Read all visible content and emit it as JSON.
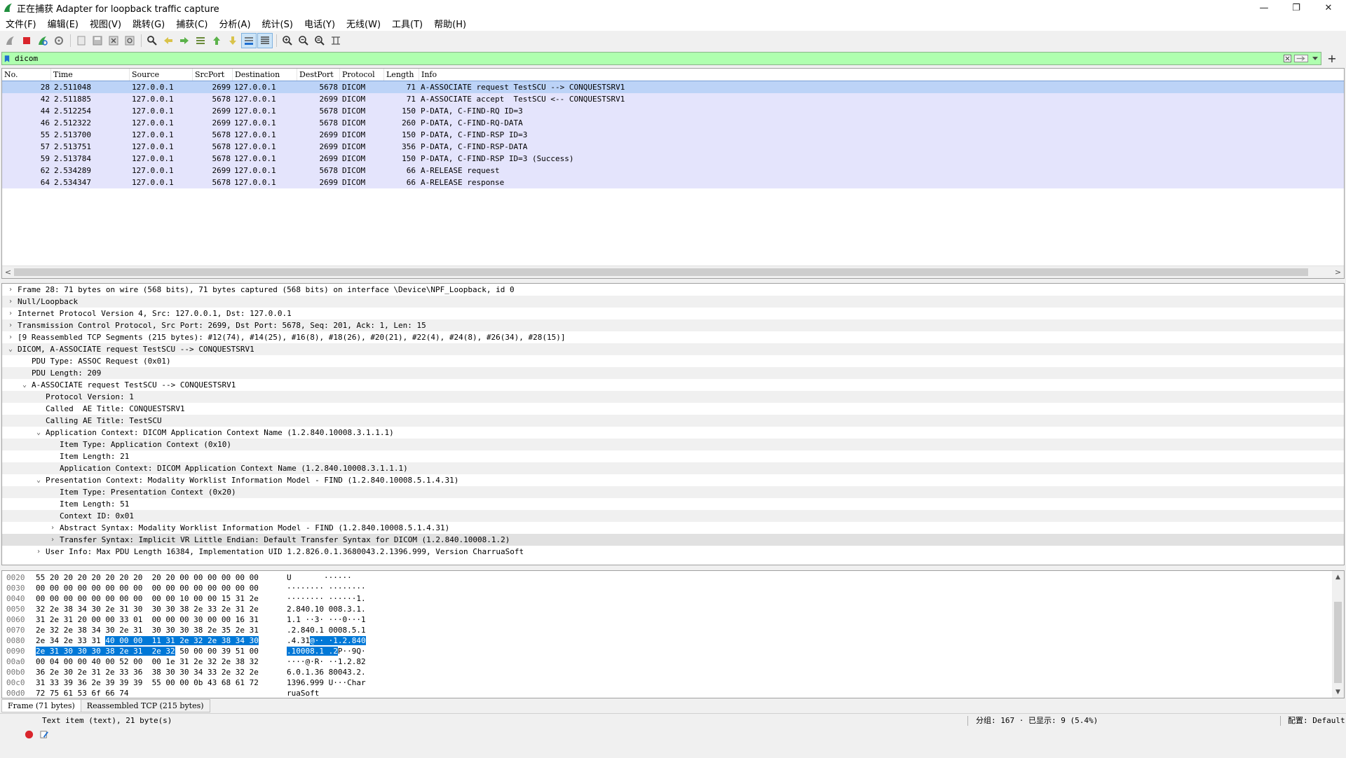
{
  "window": {
    "title": "正在捕获 Adapter for loopback traffic capture",
    "controls": {
      "minimize": "—",
      "maximize": "❐",
      "close": "✕"
    }
  },
  "menu": [
    "文件(F)",
    "编辑(E)",
    "视图(V)",
    "跳转(G)",
    "捕获(C)",
    "分析(A)",
    "统计(S)",
    "电话(Y)",
    "无线(W)",
    "工具(T)",
    "帮助(H)"
  ],
  "filter": {
    "value": "dicom",
    "plus": "+"
  },
  "colors": {
    "filter_bg": "#afffaf",
    "row_bg": "#e4e4fc",
    "row_selected": "#bcd3f7",
    "byte_selection": "#0078d7"
  },
  "packet_list": {
    "columns": [
      "No.",
      "Time",
      "Source",
      "SrcPort",
      "Destination",
      "DestPort",
      "Protocol",
      "Length",
      "Info"
    ],
    "rows": [
      {
        "no": "28",
        "time": "2.511048",
        "src": "127.0.0.1",
        "sport": "2699",
        "dst": "127.0.0.1",
        "dport": "5678",
        "proto": "DICOM",
        "len": "71",
        "info": "A-ASSOCIATE request TestSCU --> CONQUESTSRV1"
      },
      {
        "no": "42",
        "time": "2.511885",
        "src": "127.0.0.1",
        "sport": "5678",
        "dst": "127.0.0.1",
        "dport": "2699",
        "proto": "DICOM",
        "len": "71",
        "info": "A-ASSOCIATE accept  TestSCU <-- CONQUESTSRV1"
      },
      {
        "no": "44",
        "time": "2.512254",
        "src": "127.0.0.1",
        "sport": "2699",
        "dst": "127.0.0.1",
        "dport": "5678",
        "proto": "DICOM",
        "len": "150",
        "info": "P-DATA, C-FIND-RQ ID=3"
      },
      {
        "no": "46",
        "time": "2.512322",
        "src": "127.0.0.1",
        "sport": "2699",
        "dst": "127.0.0.1",
        "dport": "5678",
        "proto": "DICOM",
        "len": "260",
        "info": "P-DATA, C-FIND-RQ-DATA"
      },
      {
        "no": "55",
        "time": "2.513700",
        "src": "127.0.0.1",
        "sport": "5678",
        "dst": "127.0.0.1",
        "dport": "2699",
        "proto": "DICOM",
        "len": "150",
        "info": "P-DATA, C-FIND-RSP ID=3"
      },
      {
        "no": "57",
        "time": "2.513751",
        "src": "127.0.0.1",
        "sport": "5678",
        "dst": "127.0.0.1",
        "dport": "2699",
        "proto": "DICOM",
        "len": "356",
        "info": "P-DATA, C-FIND-RSP-DATA"
      },
      {
        "no": "59",
        "time": "2.513784",
        "src": "127.0.0.1",
        "sport": "5678",
        "dst": "127.0.0.1",
        "dport": "2699",
        "proto": "DICOM",
        "len": "150",
        "info": "P-DATA, C-FIND-RSP ID=3 (Success)"
      },
      {
        "no": "62",
        "time": "2.534289",
        "src": "127.0.0.1",
        "sport": "2699",
        "dst": "127.0.0.1",
        "dport": "5678",
        "proto": "DICOM",
        "len": "66",
        "info": "A-RELEASE request"
      },
      {
        "no": "64",
        "time": "2.534347",
        "src": "127.0.0.1",
        "sport": "5678",
        "dst": "127.0.0.1",
        "dport": "2699",
        "proto": "DICOM",
        "len": "66",
        "info": "A-RELEASE response"
      }
    ]
  },
  "details": [
    {
      "indent": 0,
      "arrow": "right",
      "text": "Frame 28: 71 bytes on wire (568 bits), 71 bytes captured (568 bits) on interface \\Device\\NPF_Loopback, id 0"
    },
    {
      "indent": 0,
      "arrow": "right",
      "text": "Null/Loopback"
    },
    {
      "indent": 0,
      "arrow": "right",
      "text": "Internet Protocol Version 4, Src: 127.0.0.1, Dst: 127.0.0.1"
    },
    {
      "indent": 0,
      "arrow": "right",
      "text": "Transmission Control Protocol, Src Port: 2699, Dst Port: 5678, Seq: 201, Ack: 1, Len: 15"
    },
    {
      "indent": 0,
      "arrow": "right",
      "text": "[9 Reassembled TCP Segments (215 bytes): #12(74), #14(25), #16(8), #18(26), #20(21), #22(4), #24(8), #26(34), #28(15)]"
    },
    {
      "indent": 0,
      "arrow": "down",
      "text": "DICOM, A-ASSOCIATE request TestSCU --> CONQUESTSRV1"
    },
    {
      "indent": 1,
      "arrow": "",
      "text": "PDU Type: ASSOC Request (0x01)"
    },
    {
      "indent": 1,
      "arrow": "",
      "text": "PDU Length: 209"
    },
    {
      "indent": 1,
      "arrow": "down",
      "text": "A-ASSOCIATE request TestSCU --> CONQUESTSRV1"
    },
    {
      "indent": 2,
      "arrow": "",
      "text": "Protocol Version: 1"
    },
    {
      "indent": 2,
      "arrow": "",
      "text": "Called  AE Title: CONQUESTSRV1"
    },
    {
      "indent": 2,
      "arrow": "",
      "text": "Calling AE Title: TestSCU"
    },
    {
      "indent": 2,
      "arrow": "down",
      "text": "Application Context: DICOM Application Context Name (1.2.840.10008.3.1.1.1)"
    },
    {
      "indent": 3,
      "arrow": "",
      "text": "Item Type: Application Context (0x10)"
    },
    {
      "indent": 3,
      "arrow": "",
      "text": "Item Length: 21"
    },
    {
      "indent": 3,
      "arrow": "",
      "text": "Application Context: DICOM Application Context Name (1.2.840.10008.3.1.1.1)"
    },
    {
      "indent": 2,
      "arrow": "down",
      "text": "Presentation Context: Modality Worklist Information Model - FIND (1.2.840.10008.5.1.4.31)"
    },
    {
      "indent": 3,
      "arrow": "",
      "text": "Item Type: Presentation Context (0x20)"
    },
    {
      "indent": 3,
      "arrow": "",
      "text": "Item Length: 51"
    },
    {
      "indent": 3,
      "arrow": "",
      "text": "Context ID: 0x01"
    },
    {
      "indent": 3,
      "arrow": "right",
      "text": "Abstract Syntax: Modality Worklist Information Model - FIND (1.2.840.10008.5.1.4.31)"
    },
    {
      "indent": 3,
      "arrow": "right",
      "text": "Transfer Syntax: Implicit VR Little Endian: Default Transfer Syntax for DICOM (1.2.840.10008.1.2)",
      "highlight": true
    },
    {
      "indent": 2,
      "arrow": "right",
      "text": "User Info: Max PDU Length 16384, Implementation UID 1.2.826.0.1.3680043.2.1396.999, Version CharruaSoft"
    }
  ],
  "bytes": [
    {
      "off": "0020",
      "pre": "55 20 20 20 20 20 20 20  20 20 00 00 00 00 00 00",
      "sel": "",
      "post": "",
      "apre": "U       ······",
      "asel": "",
      "apost": ""
    },
    {
      "off": "0030",
      "pre": "00 00 00 00 00 00 00 00  00 00 00 00 00 00 00 00",
      "sel": "",
      "post": "",
      "apre": "········ ········",
      "asel": "",
      "apost": ""
    },
    {
      "off": "0040",
      "pre": "00 00 00 00 00 00 00 00  00 00 10 00 00 15 31 2e",
      "sel": "",
      "post": "",
      "apre": "········ ······1.",
      "asel": "",
      "apost": ""
    },
    {
      "off": "0050",
      "pre": "32 2e 38 34 30 2e 31 30  30 30 38 2e 33 2e 31 2e",
      "sel": "",
      "post": "",
      "apre": "2.840.10 008.3.1.",
      "asel": "",
      "apost": ""
    },
    {
      "off": "0060",
      "pre": "31 2e 31 20 00 00 33 01  00 00 00 30 00 00 16 31",
      "sel": "",
      "post": "",
      "apre": "1.1 ··3· ···0···1",
      "asel": "",
      "apost": ""
    },
    {
      "off": "0070",
      "pre": "2e 32 2e 38 34 30 2e 31  30 30 30 38 2e 35 2e 31",
      "sel": "",
      "post": "",
      "apre": ".2.840.1 0008.5.1",
      "asel": "",
      "apost": ""
    },
    {
      "off": "0080",
      "pre": "2e 34 2e 33 31 ",
      "sel": "40 00 00  11 31 2e 32 2e 38 34 30",
      "post": "",
      "apre": ".4.31",
      "asel": "@·· ·1.2.840",
      "apost": ""
    },
    {
      "off": "0090",
      "pre": "",
      "sel": "2e 31 30 30 30 38 2e 31  2e 32",
      "post": " 50 00 00 39 51 00",
      "apre": "",
      "asel": ".10008.1 .2",
      "apost": "P··9Q·"
    },
    {
      "off": "00a0",
      "pre": "00 04 00 00 40 00 52 00  00 1e 31 2e 32 2e 38 32",
      "sel": "",
      "post": "",
      "apre": "····@·R· ··1.2.82",
      "asel": "",
      "apost": ""
    },
    {
      "off": "00b0",
      "pre": "36 2e 30 2e 31 2e 33 36  38 30 30 34 33 2e 32 2e",
      "sel": "",
      "post": "",
      "apre": "6.0.1.36 80043.2.",
      "asel": "",
      "apost": ""
    },
    {
      "off": "00c0",
      "pre": "31 33 39 36 2e 39 39 39  55 00 00 0b 43 68 61 72",
      "sel": "",
      "post": "",
      "apre": "1396.999 U···Char",
      "asel": "",
      "apost": ""
    },
    {
      "off": "00d0",
      "pre": "72 75 61 53 6f 66 74",
      "sel": "",
      "post": "",
      "apre": "ruaSoft",
      "asel": "",
      "apost": ""
    }
  ],
  "byte_tabs": [
    "Frame (71 bytes)",
    "Reassembled TCP (215 bytes)"
  ],
  "status": {
    "text": "Text item (text), 21 byte(s)",
    "packets": "分组: 167 · 已显示: 9 (5.4%)",
    "profile": "配置: Default"
  }
}
